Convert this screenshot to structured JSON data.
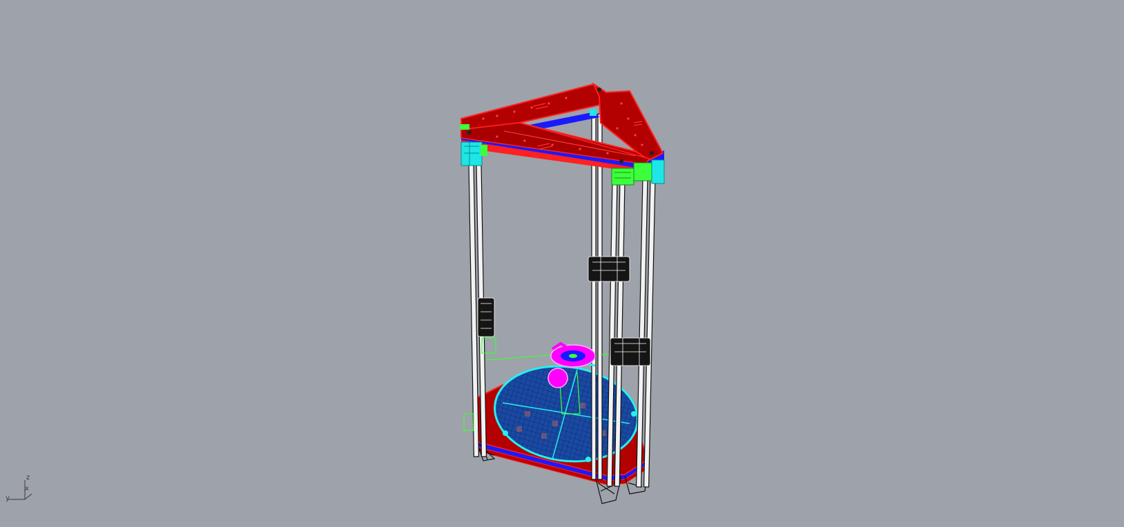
{
  "viewport": {
    "name": "perspective-viewport",
    "background": "#9ea2aa"
  },
  "model": {
    "frame_color": "#b30000",
    "frame_edge": "#ff2020",
    "blue_layer": "#1a1aff",
    "bracket_cyan": "#1ee6e6",
    "bracket_green": "#3cff3c",
    "effector_magenta": "#ff00ff",
    "bed_blue": "#1a4aa0",
    "bed_grid": "#0a2a80",
    "bed_outline": "#24f0f0",
    "rod_color": "#f2f2f2",
    "rod_edge": "#111111"
  },
  "axes": {
    "z_label": "z",
    "x_label": "x",
    "y_label": "y"
  }
}
